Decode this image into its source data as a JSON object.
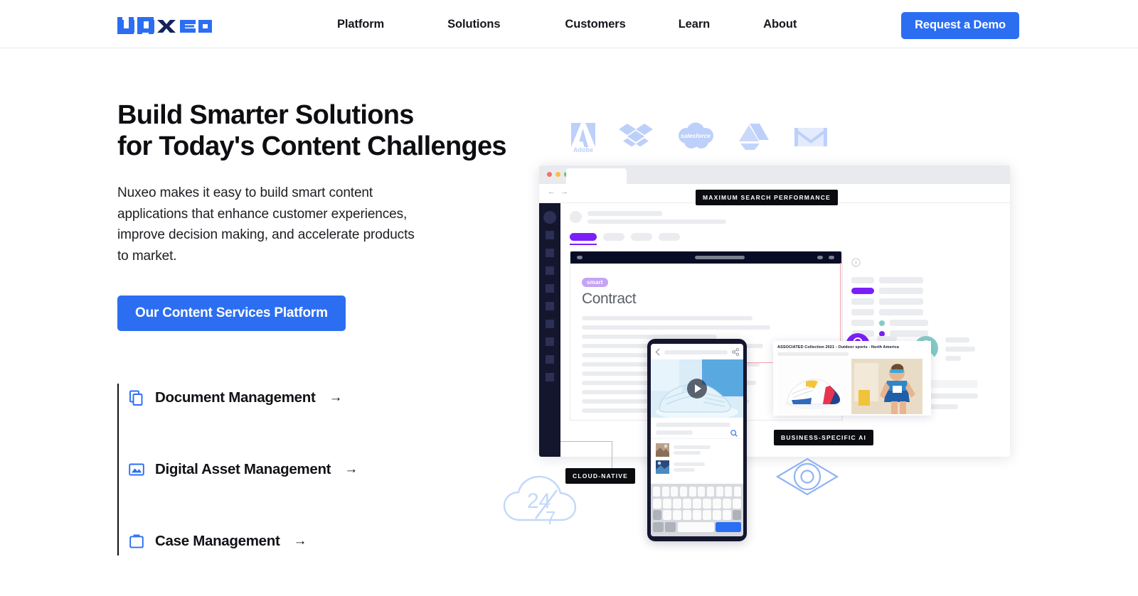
{
  "header": {
    "logo_text": "nuxeo",
    "nav": [
      {
        "label": "Platform"
      },
      {
        "label": "Solutions"
      },
      {
        "label": "Customers"
      },
      {
        "label": "Learn"
      },
      {
        "label": "About"
      }
    ],
    "cta_label": "Request a Demo",
    "cta_color": "#2c6ef2"
  },
  "hero": {
    "title": "Build Smarter Solutions\nfor Today's Content Challenges",
    "paragraph": "Nuxeo makes it easy to build smart content applications that enhance customer experiences, improve decision making, and accelerate products to market.",
    "cta_label": "Our Content Services Platform",
    "features": [
      {
        "label": "Document Management",
        "arrow": "→",
        "icon": "documents-icon"
      },
      {
        "label": "Digital Asset Management",
        "arrow": "→",
        "icon": "image-icon"
      },
      {
        "label": "Case Management",
        "arrow": "→",
        "icon": "briefcase-icon"
      }
    ]
  },
  "illustration": {
    "integration_logos": [
      {
        "name": "adobe-logo",
        "label": "Adobe"
      },
      {
        "name": "dropbox-logo",
        "label": "Dropbox"
      },
      {
        "name": "salesforce-logo",
        "label": "salesforce"
      },
      {
        "name": "google-drive-logo",
        "label": "Google Drive"
      },
      {
        "name": "gmail-logo",
        "label": "Gmail"
      }
    ],
    "badges": {
      "search": "MAXIMUM SEARCH PERFORMANCE",
      "cloud": "CLOUD-NATIVE",
      "ai": "BUSINESS-SPECIFIC AI"
    },
    "document": {
      "tag": "smart",
      "title": "Contract"
    },
    "product_card": {
      "label": "ASSOCIATED Collection 2021 - Outdoor sports - North America"
    },
    "deco": {
      "cloud_top": "24",
      "cloud_bottom": "7",
      "cloud_name": "cloud-24-7-icon",
      "eye_name": "eye-icon"
    },
    "accent_purple": "#7b1ffa",
    "accent_teal": "#86cbc8",
    "dark_navy": "#14162e"
  }
}
